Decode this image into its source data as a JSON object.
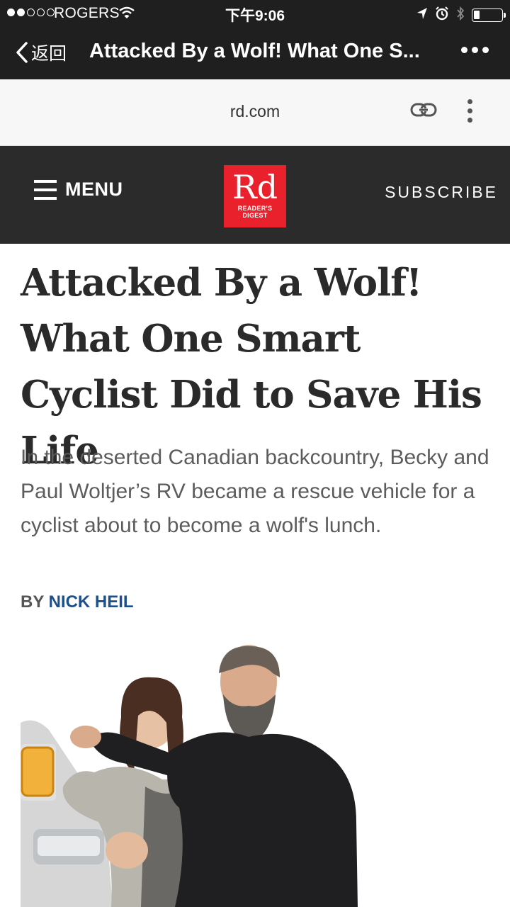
{
  "status_bar": {
    "carrier": "ROGERS",
    "time": "下午9:06",
    "signal_bars_filled": 2,
    "signal_bars_total": 5,
    "icons": [
      "wifi-icon",
      "location-arrow-icon",
      "alarm-icon",
      "bluetooth-icon",
      "battery-icon"
    ]
  },
  "nav_bar": {
    "back_label": "返回",
    "title": "Attacked By a Wolf! What One S..."
  },
  "address_bar": {
    "domain": "rd.com"
  },
  "site_header": {
    "menu_label": "MENU",
    "logo_text": "Rd",
    "logo_subtext_line1": "READER'S",
    "logo_subtext_line2": "DIGEST",
    "subscribe_label": "SUBSCRIBE"
  },
  "article": {
    "headline": "Attacked By a Wolf! What One Smart Cyclist Did to Save His Life",
    "dek": "In the deserted Canadian backcountry, Becky and Paul Woltjer’s RV became a rescue vehicle for a cyclist about to become a wolf's lunch.",
    "byline_prefix": "BY",
    "author": "NICK HEIL"
  },
  "colors": {
    "chrome_dark": "#1f1f1f",
    "site_header": "#2b2b2b",
    "logo_red": "#e8212c",
    "author_blue": "#1d4f8c",
    "headline_text": "#2a2a2a",
    "dek_text": "#5c5c5c"
  }
}
